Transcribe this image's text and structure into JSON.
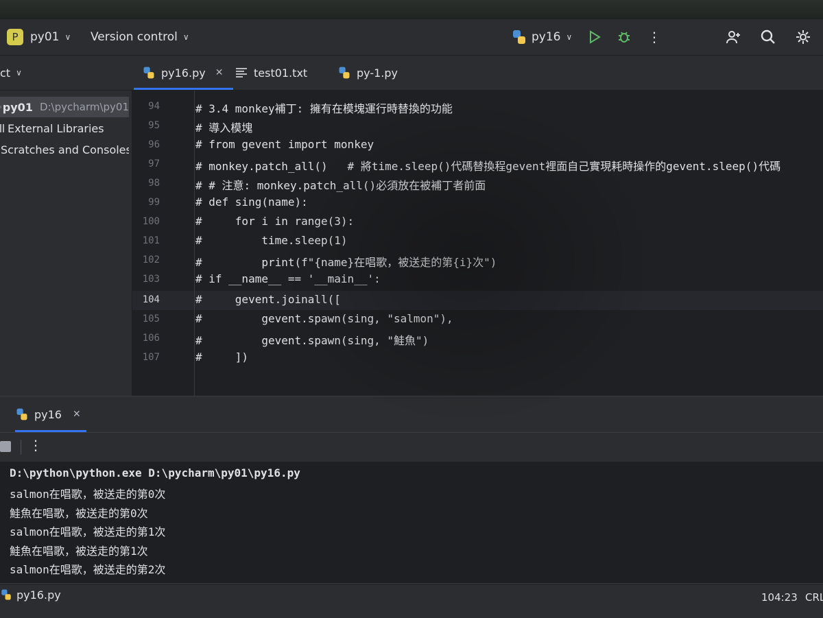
{
  "titlebar": {
    "project_badge": "P",
    "project_name": "py01",
    "version_control": "Version control",
    "run_config": "py16"
  },
  "tabs": [
    {
      "label": "py16.py",
      "icon": "python-file-icon",
      "active": true
    },
    {
      "label": "test01.txt",
      "icon": "text-file-icon",
      "active": false
    },
    {
      "label": "py-1.py",
      "icon": "python-file-icon",
      "active": false
    }
  ],
  "project_panel": {
    "header": "ct",
    "items": [
      {
        "name": "py01",
        "path": "D:\\pycharm\\py01"
      },
      {
        "name": "External Libraries"
      },
      {
        "name": "Scratches and Consoles"
      }
    ]
  },
  "editor": {
    "current_line": "104",
    "lines": [
      {
        "num": "94",
        "text": "# 3.4 monkey補丁: 擁有在模塊運行時替換的功能"
      },
      {
        "num": "95",
        "text": "# 導入模塊"
      },
      {
        "num": "96",
        "text": "# from gevent import monkey"
      },
      {
        "num": "97",
        "text": "# monkey.patch_all()   # 將time.sleep()代碼替換程gevent裡面自己實現耗時操作的gevent.sleep()代碼"
      },
      {
        "num": "98",
        "text": "# # 注意: monkey.patch_all()必須放在被補丁者前面"
      },
      {
        "num": "99",
        "text": "# def sing(name):"
      },
      {
        "num": "100",
        "text": "#     for i in range(3):"
      },
      {
        "num": "101",
        "text": "#         time.sleep(1)"
      },
      {
        "num": "102",
        "text": "#         print(f\"{name}在唱歌，被送走的第{i}次\")"
      },
      {
        "num": "103",
        "text": "# if __name__ == '__main__':"
      },
      {
        "num": "104",
        "text": "#     gevent.joinall(["
      },
      {
        "num": "105",
        "text": "#         gevent.spawn(sing, \"salmon\"),"
      },
      {
        "num": "106",
        "text": "#         gevent.spawn(sing, \"鮭魚\")"
      },
      {
        "num": "107",
        "text": "#     ])"
      }
    ]
  },
  "run_panel": {
    "tab_label": "py16",
    "output": [
      "D:\\python\\python.exe D:\\pycharm\\py01\\py16.py",
      "salmon在唱歌，被送走的第0次",
      "鮭魚在唱歌，被送走的第0次",
      "salmon在唱歌，被送走的第1次",
      "鮭魚在唱歌，被送走的第1次",
      "salmon在唱歌，被送走的第2次"
    ]
  },
  "statusbar": {
    "file": "py16.py",
    "position": "104:23",
    "line_sep": "CRL"
  },
  "colors": {
    "accent": "#3574f0",
    "run_green": "#5fb865",
    "project_badge": "#d5cc4e"
  }
}
